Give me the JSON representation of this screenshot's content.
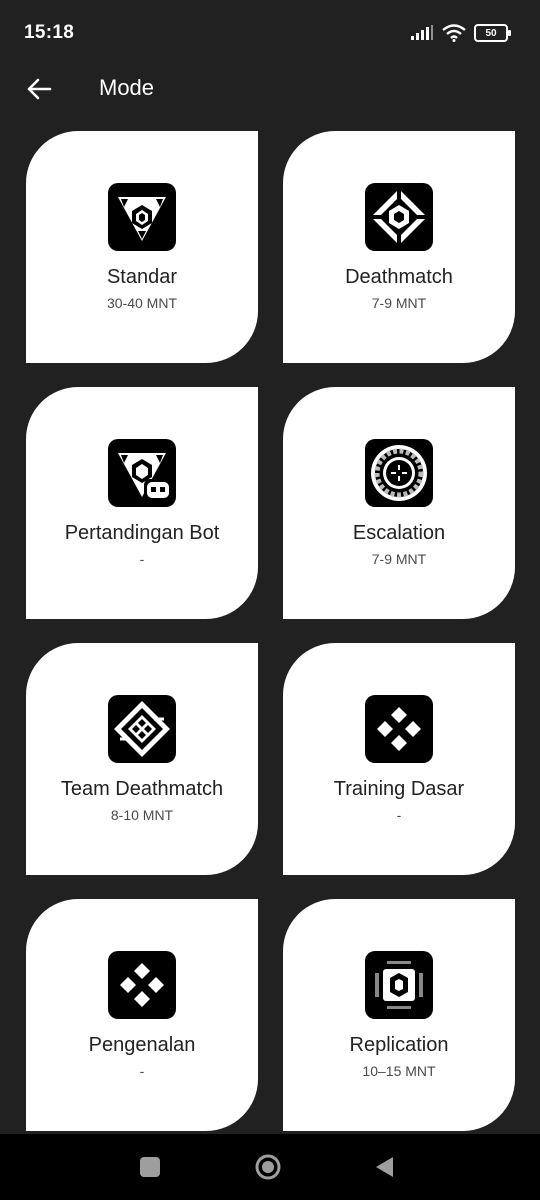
{
  "status_bar": {
    "time": "15:18",
    "battery": "50",
    "icons": [
      "signal-icon",
      "wifi-icon",
      "battery-icon"
    ]
  },
  "app_bar": {
    "back_icon": "arrow-left-icon",
    "title": "Mode"
  },
  "modes": [
    {
      "name": "Standar",
      "duration": "30-40 MNT",
      "icon": "standard-mode-icon"
    },
    {
      "name": "Deathmatch",
      "duration": "7-9 MNT",
      "icon": "deathmatch-mode-icon"
    },
    {
      "name": "Pertandingan Bot",
      "duration": "-",
      "icon": "bot-match-mode-icon"
    },
    {
      "name": "Escalation",
      "duration": "7-9 MNT",
      "icon": "escalation-mode-icon"
    },
    {
      "name": "Team Deathmatch",
      "duration": "8-10 MNT",
      "icon": "team-deathmatch-mode-icon"
    },
    {
      "name": "Training Dasar",
      "duration": "-",
      "icon": "basic-training-mode-icon"
    },
    {
      "name": "Pengenalan",
      "duration": "-",
      "icon": "introduction-mode-icon"
    },
    {
      "name": "Replication",
      "duration": "10–15 MNT",
      "icon": "replication-mode-icon"
    }
  ],
  "nav_bar": {
    "icons": [
      "recent-apps-icon",
      "home-icon",
      "back-icon"
    ]
  },
  "colors": {
    "background": "#212121",
    "card": "#ffffff",
    "icon_tile": "#000000",
    "nav_bar": "#000000"
  }
}
